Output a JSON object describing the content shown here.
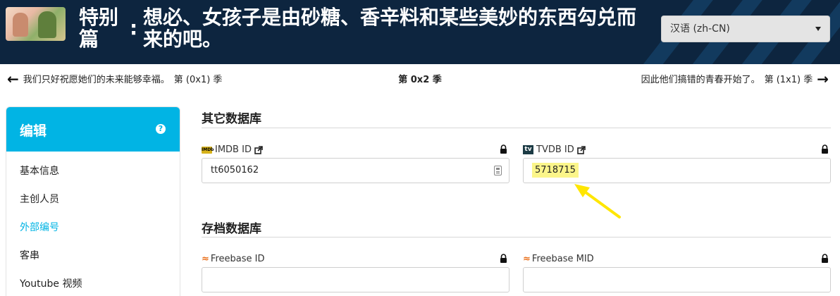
{
  "header": {
    "episode_prefix": "特别篇",
    "colon": ":",
    "episode_title": "想必、女孩子是由砂糖、香辛料和某些美妙的东西勾兑而来的吧。",
    "language": "汉语 (zh-CN)",
    "bg_color": "#0d253f"
  },
  "season_nav": {
    "prev_label": "我们只好祝愿她们的未来能够幸福。",
    "prev_code": "第 (0x1) 季",
    "current": "第 0x2 季",
    "next_label": "因此他们搞错的青春开始了。",
    "next_code": "第 (1x1) 季"
  },
  "sidebar": {
    "title": "编辑",
    "accent": "#01b4e4",
    "items": [
      {
        "label": "基本信息",
        "active": false
      },
      {
        "label": "主创人员",
        "active": false
      },
      {
        "label": "外部编号",
        "active": true
      },
      {
        "label": "客串",
        "active": false
      },
      {
        "label": "Youtube 视频",
        "active": false
      }
    ]
  },
  "other_db": {
    "section_title": "其它数据库",
    "imdb": {
      "label": "IMDB ID",
      "value": "tt6050162"
    },
    "tvdb": {
      "label": "TVDB ID",
      "value": "5718715"
    }
  },
  "archive_db": {
    "section_title": "存档数据库",
    "freebase_id": {
      "label": "Freebase ID",
      "value": ""
    },
    "freebase_mid": {
      "label": "Freebase MID",
      "value": ""
    }
  }
}
